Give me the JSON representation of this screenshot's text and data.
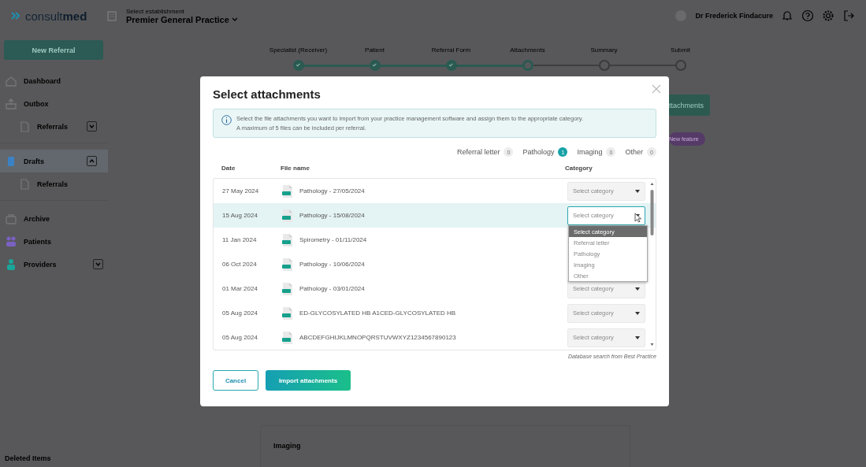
{
  "header": {
    "logo": "consult**med**",
    "establishment_label": "Select establishment",
    "establishment": "Premier General Practice",
    "user": "Dr Frederick Findacure"
  },
  "sidebar": {
    "new_button": "New Referral",
    "items": [
      {
        "label": "Dashboard",
        "kind": "home",
        "selected": false
      },
      {
        "label": "Outbox",
        "kind": "outbox",
        "selected": false,
        "children": [
          {
            "label": "Referrals",
            "kind": "doc",
            "selected": false,
            "expanded": false
          }
        ]
      },
      {
        "label": "Drafts",
        "kind": "drafts",
        "selected": true,
        "expanded": true,
        "children": [
          {
            "label": "Referrals",
            "kind": "doc",
            "selected": false
          }
        ]
      },
      {
        "label": "Archive",
        "kind": "archive",
        "selected": false
      },
      {
        "label": "Patients",
        "kind": "patients",
        "selected": false
      },
      {
        "label": "Providers",
        "kind": "providers",
        "selected": false,
        "expanded": false
      }
    ],
    "footer_item": "Deleted Items"
  },
  "steps": [
    {
      "label": "Specialist (Receiver)",
      "completed": true,
      "selected": false
    },
    {
      "label": "Patient",
      "completed": true,
      "selected": false
    },
    {
      "label": "Referral Form",
      "completed": true,
      "selected": false
    },
    {
      "label": "Attachments",
      "completed": false,
      "selected": true
    },
    {
      "label": "Summary",
      "completed": false,
      "selected": false
    },
    {
      "label": "Submit",
      "completed": false,
      "selected": false
    }
  ],
  "background": {
    "attachments_button": "ttachments",
    "feature_badge": "New feature",
    "section_heading": "Imaging"
  },
  "modal": {
    "title": "Select attachments",
    "info": [
      "Select the file attachments you want to import from your practice management software and assign them to the appropriate category.",
      "A maximum of 5 files can be included per referral."
    ],
    "counters": [
      {
        "label": "Referral letter",
        "count": "0",
        "highlighted": false
      },
      {
        "label": "Pathology",
        "count": "1",
        "highlighted": true
      },
      {
        "label": "Imaging",
        "count": "0",
        "highlighted": false
      },
      {
        "label": "Other",
        "count": "0",
        "highlighted": false
      }
    ],
    "columns": [
      "Date",
      "File name",
      "Category"
    ],
    "rows": [
      {
        "date": "27 May 2024",
        "file": "Pathology - 27/05/2024",
        "category": "Select category",
        "focused": false
      },
      {
        "date": "15 Aug 2024",
        "file": "Pathology - 15/08/2024",
        "category": "Select category",
        "focused": true,
        "options": [
          {
            "label": "Select category",
            "selected": true
          },
          {
            "label": "Referral letter",
            "selected": false
          },
          {
            "label": "Pathology",
            "selected": false
          },
          {
            "label": "Imaging",
            "selected": false
          },
          {
            "label": "Other",
            "selected": false
          }
        ]
      },
      {
        "date": "11 Jan 2024",
        "file": "Spirometry - 01/11/2024",
        "focused": false
      },
      {
        "date": "06 Oct 2024",
        "file": "Pathology - 10/06/2024",
        "focused": false
      },
      {
        "date": "01 Mar 2024",
        "file": "Pathology - 03/01/2024",
        "category": "Select category",
        "focused": false
      },
      {
        "date": "05 Aug 2024",
        "file": "ED-GLYCOSYLATED HB A1CED-GLYCOSYLATED HB",
        "category": "Select category",
        "focused": false
      },
      {
        "date": "05 Aug 2024",
        "file": "ABCDEFGHIJKLMNOPQRSTUVWXYZ1234567890123",
        "category": "Select category",
        "focused": false
      }
    ],
    "footnote": "Database search from Best Practice",
    "cancel": "Cancel",
    "import": "Import attachments"
  }
}
